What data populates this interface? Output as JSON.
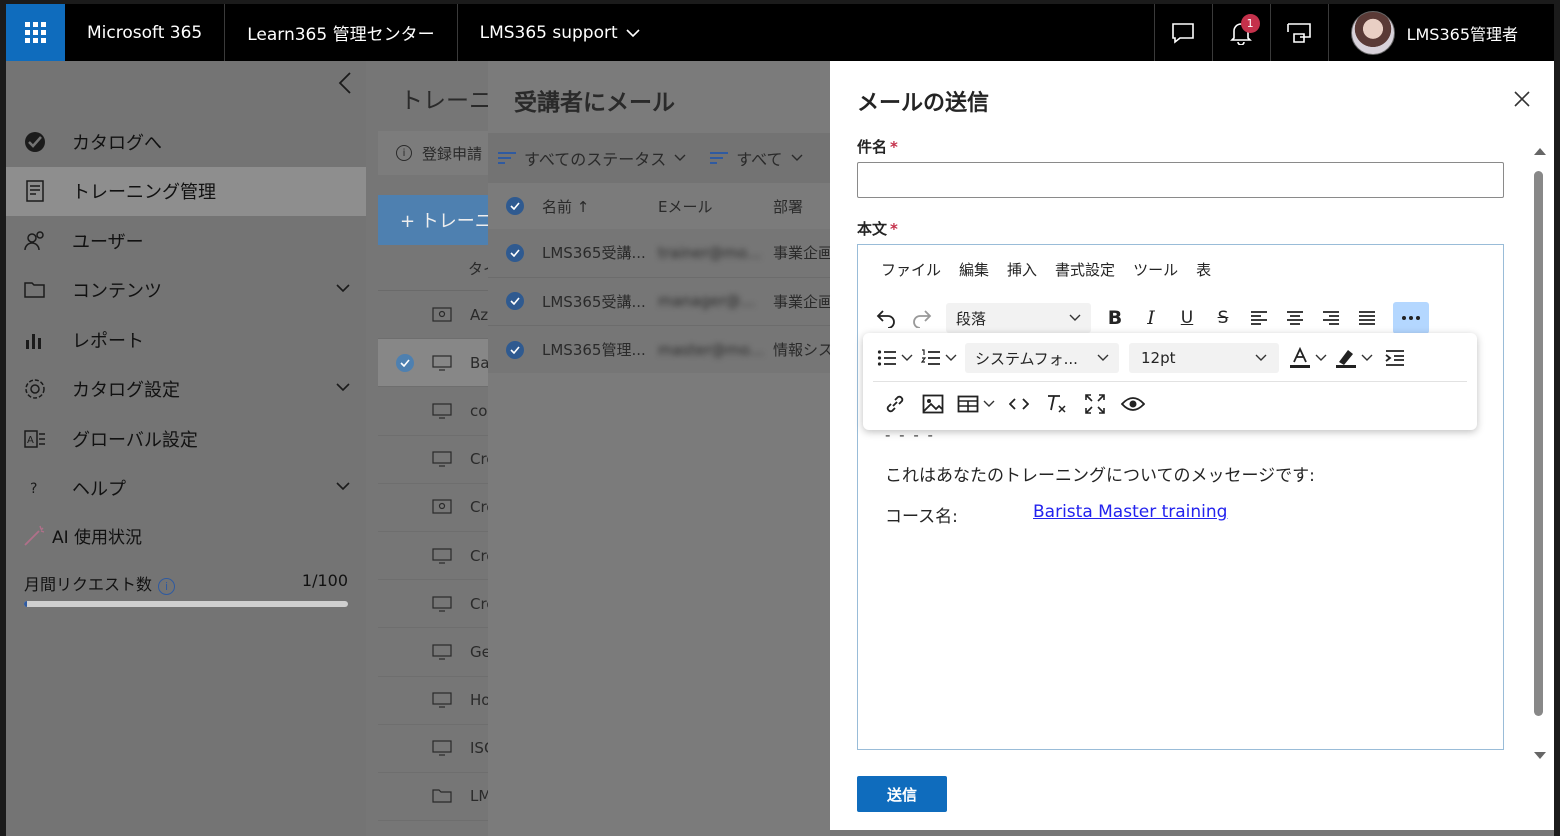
{
  "topbar": {
    "brand": "Microsoft 365",
    "app": "Learn365 管理センター",
    "org": "LMS365 support",
    "notification_count": "1",
    "user_name": "LMS365管理者"
  },
  "sidebar": {
    "items": [
      {
        "label": "カタログへ"
      },
      {
        "label": "トレーニング管理"
      },
      {
        "label": "ユーザー"
      },
      {
        "label": "コンテンツ"
      },
      {
        "label": "レポート"
      },
      {
        "label": "カタログ設定"
      },
      {
        "label": "グローバル設定"
      },
      {
        "label": "ヘルプ"
      }
    ],
    "ai": {
      "title": "AI 使用状況",
      "requests_label": "月間リクエスト数",
      "requests_value": "1/100",
      "progress_fraction": 0.01
    }
  },
  "main": {
    "title": "トレーニン",
    "info_text": "登録申請",
    "new_button": "+ トレーニ",
    "list_header": "タイ",
    "rows": [
      "Azu",
      "Bar",
      "cou",
      "Cre",
      "Cre",
      "Cre",
      "Cre",
      "Ge",
      "Ho",
      "ISC",
      "LM"
    ]
  },
  "mid": {
    "title": "受講者にメール",
    "filter_status": "すべてのステータス",
    "filter_all": "すべて",
    "columns": {
      "name": "名前 ↑",
      "email": "Eメール",
      "dept": "部署"
    },
    "rows": [
      {
        "name": "LMS365受講...",
        "email": "trainer@mo...",
        "dept": "事業企画"
      },
      {
        "name": "LMS365受講...",
        "email": "manager@...",
        "dept": "事業企画"
      },
      {
        "name": "LMS365管理...",
        "email": "master@mo...",
        "dept": "情報シス"
      }
    ]
  },
  "panel": {
    "title": "メールの送信",
    "subject_label": "件名",
    "subject_value": "",
    "body_label": "本文",
    "required_mark": "*",
    "menu": [
      "ファイル",
      "編集",
      "挿入",
      "書式設定",
      "ツール",
      "表"
    ],
    "paragraph_select": "段落",
    "font_select": "システムフォ...",
    "size_select": "12pt",
    "body_dashes": "- - - -",
    "body_message": "これはあなたのトレーニングについてのメッセージです:",
    "course_label": "コース名:",
    "course_link": "Barista Master training",
    "send_button": "送信"
  },
  "colors": {
    "accent": "#0f6cbd",
    "badge": "#c4314b",
    "link": "#2222ee",
    "overlay": "#767676"
  }
}
